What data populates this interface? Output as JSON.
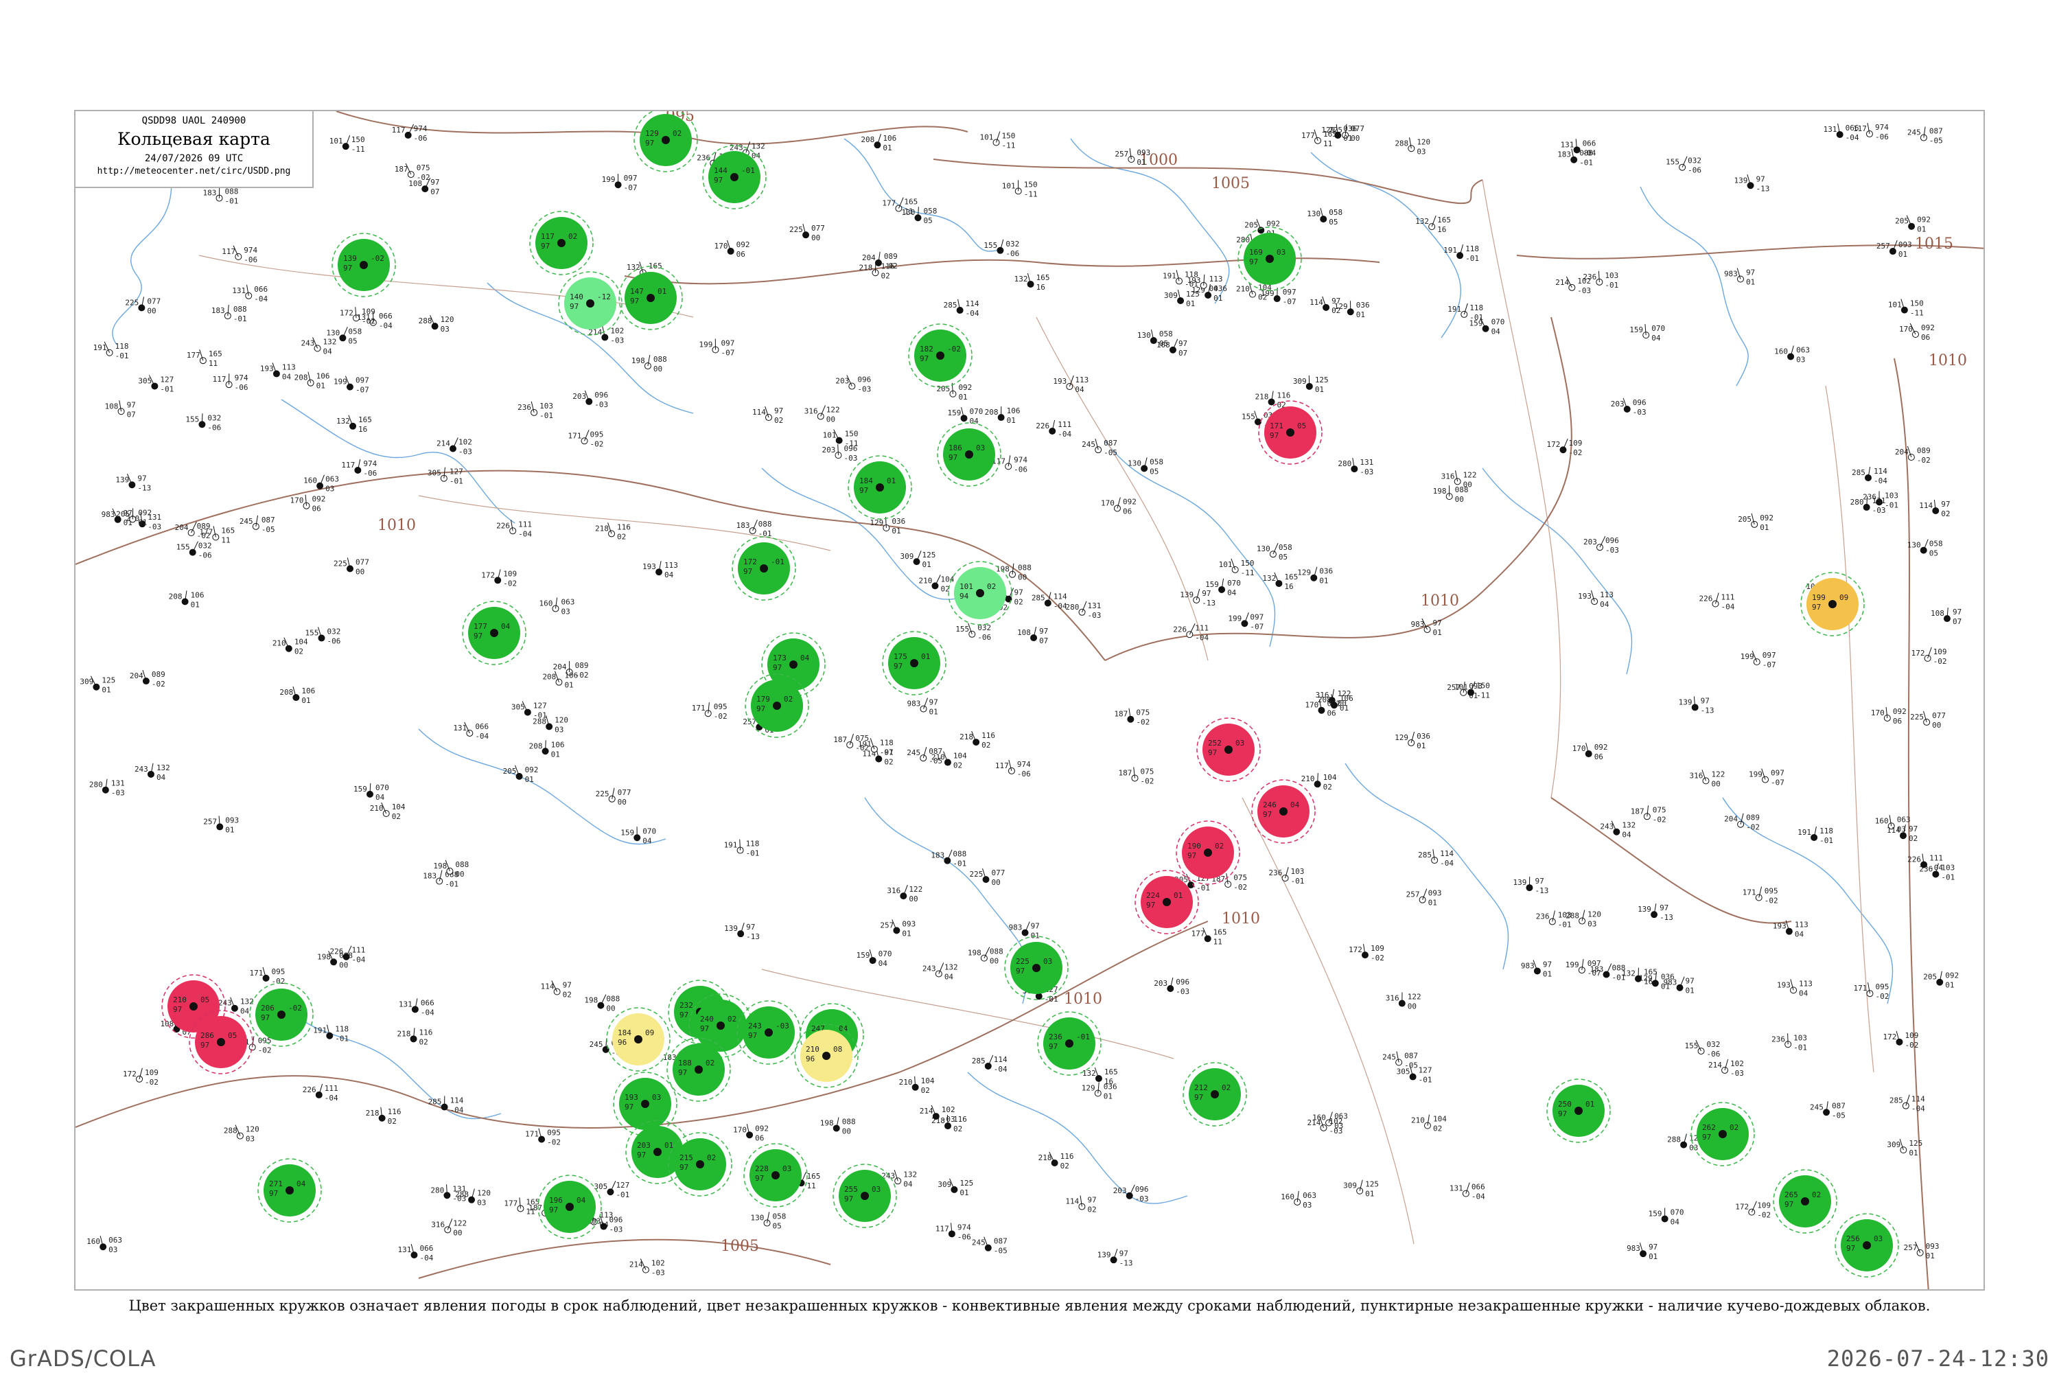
{
  "header": {
    "code": "QSDD98  UAOL  240900",
    "title": "Кольцевая карта",
    "date": "24/07/2026 09 UTC",
    "url": "http://meteocenter.net/circ/USDD.png"
  },
  "isobars": [
    "995",
    "1000",
    "1005",
    "1010",
    "1015",
    "1010",
    "1010",
    "1010",
    "1010",
    "1010",
    "1005"
  ],
  "caption": "Цвет закрашенных кружков означает явления погоды в срок наблюдений, цвет незакрашенных кружков - конвективные явления между сроками наблюдений, пунктирные незакрашенные кружки - наличие кучево-дождевых облаков.",
  "footer": {
    "left": "GrADS/COLA",
    "right": "2026-07-24-12:30"
  },
  "colors": {
    "map_background": "#ffffff",
    "rivers": "#6aa7e0",
    "borders": "#c8a090",
    "isobars": "#a0705f",
    "rain_fill": "#22b830",
    "shower_fill": "#6de88a",
    "thunder_fill": "#e8305a",
    "haze_fill": "#f4c24a",
    "fog_fill": "#f6ea8a",
    "cb_ring": "#3cb84a",
    "thunder_ring": "#d83060"
  },
  "station_samples": [
    {
      "n": "117",
      "p": "974",
      "t": "-06"
    },
    {
      "n": "983",
      "p": "97",
      "t": "01"
    },
    {
      "n": "139",
      "p": "97",
      "t": "-13"
    },
    {
      "n": "130",
      "p": "058",
      "t": "05"
    },
    {
      "n": "129",
      "p": "036",
      "t": "01"
    },
    {
      "n": "108",
      "p": "97",
      "t": "07"
    },
    {
      "n": "155",
      "p": "032",
      "t": "-06"
    },
    {
      "n": "114",
      "p": "97",
      "t": "02"
    },
    {
      "n": "131",
      "p": "066",
      "t": "-04"
    },
    {
      "n": "170",
      "p": "092",
      "t": "06"
    },
    {
      "n": "183",
      "p": "088",
      "t": "-01"
    },
    {
      "n": "171",
      "p": "095",
      "t": "-02"
    },
    {
      "n": "159",
      "p": "070",
      "t": "04"
    },
    {
      "n": "199",
      "p": "097",
      "t": "-07"
    },
    {
      "n": "208",
      "p": "106",
      "t": "01"
    },
    {
      "n": "236",
      "p": "103",
      "t": "-01"
    },
    {
      "n": "210",
      "p": "104",
      "t": "02"
    },
    {
      "n": "203",
      "p": "096",
      "t": "-03"
    },
    {
      "n": "198",
      "p": "088",
      "t": "00"
    },
    {
      "n": "245",
      "p": "087",
      "t": "-05"
    },
    {
      "n": "257",
      "p": "093",
      "t": "01"
    },
    {
      "n": "172",
      "p": "109",
      "t": "-02"
    },
    {
      "n": "193",
      "p": "113",
      "t": "04"
    },
    {
      "n": "226",
      "p": "111",
      "t": "-04"
    },
    {
      "n": "218",
      "p": "116",
      "t": "02"
    },
    {
      "n": "191",
      "p": "118",
      "t": "-01"
    },
    {
      "n": "225",
      "p": "077",
      "t": "00"
    },
    {
      "n": "160",
      "p": "063",
      "t": "03"
    },
    {
      "n": "187",
      "p": "075",
      "t": "-02"
    },
    {
      "n": "132",
      "p": "165",
      "t": "16"
    },
    {
      "n": "101",
      "p": "150",
      "t": "-11"
    },
    {
      "n": "177",
      "p": "165",
      "t": "11"
    },
    {
      "n": "214",
      "p": "102",
      "t": "-03"
    },
    {
      "n": "205",
      "p": "092",
      "t": "01"
    },
    {
      "n": "204",
      "p": "089",
      "t": "-02"
    },
    {
      "n": "243",
      "p": "132",
      "t": "04"
    },
    {
      "n": "285",
      "p": "114",
      "t": "-04"
    },
    {
      "n": "288",
      "p": "120",
      "t": "03"
    },
    {
      "n": "305",
      "p": "127",
      "t": "-01"
    },
    {
      "n": "309",
      "p": "125",
      "t": "01"
    },
    {
      "n": "280",
      "p": "131",
      "t": "-03"
    },
    {
      "n": "316",
      "p": "122",
      "t": "00"
    }
  ],
  "marker_stations": [
    {
      "t": "rain",
      "v1": "129",
      "v2": "97",
      "v3": "02"
    },
    {
      "t": "rain",
      "v1": "144",
      "v2": "97",
      "v3": "-01"
    },
    {
      "t": "rain",
      "v1": "139",
      "v2": "97",
      "v3": "-02"
    },
    {
      "t": "rain",
      "v1": "117",
      "v2": "97",
      "v3": "02"
    },
    {
      "t": "shower",
      "v1": "140",
      "v2": "97",
      "v3": "-12"
    },
    {
      "t": "rain",
      "v1": "147",
      "v2": "97",
      "v3": "01"
    },
    {
      "t": "rain",
      "v1": "169",
      "v2": "97",
      "v3": "03"
    },
    {
      "t": "thunder",
      "v1": "171",
      "v2": "97",
      "v3": "05"
    },
    {
      "t": "rain",
      "v1": "177",
      "v2": "97",
      "v3": "04"
    },
    {
      "t": "rain",
      "v1": "182",
      "v2": "97",
      "v3": "-02"
    },
    {
      "t": "rain",
      "v1": "184",
      "v2": "97",
      "v3": "01"
    },
    {
      "t": "rain",
      "v1": "186",
      "v2": "97",
      "v3": "03"
    },
    {
      "t": "shower",
      "v1": "101",
      "v2": "94",
      "v3": "02"
    },
    {
      "t": "rain",
      "v1": "172",
      "v2": "97",
      "v3": "-01"
    },
    {
      "t": "rain",
      "v1": "173",
      "v2": "97",
      "v3": "04"
    },
    {
      "t": "rain",
      "v1": "179",
      "v2": "97",
      "v3": "02"
    },
    {
      "t": "rain",
      "v1": "175",
      "v2": "97",
      "v3": "01"
    },
    {
      "t": "thunder",
      "v1": "252",
      "v2": "97",
      "v3": "03"
    },
    {
      "t": "thunder",
      "v1": "246",
      "v2": "97",
      "v3": "04"
    },
    {
      "t": "thunder",
      "v1": "190",
      "v2": "97",
      "v3": "02"
    },
    {
      "t": "thunder",
      "v1": "224",
      "v2": "97",
      "v3": "01"
    },
    {
      "t": "haze",
      "v1": "199",
      "v2": "97",
      "v3": "09"
    },
    {
      "t": "thunder",
      "v1": "210",
      "v2": "97",
      "v3": "05"
    },
    {
      "t": "rain",
      "v1": "206",
      "v2": "97",
      "v3": "-02"
    },
    {
      "t": "rain",
      "v1": "225",
      "v2": "97",
      "v3": "03"
    },
    {
      "t": "rain",
      "v1": "232",
      "v2": "97",
      "v3": "01"
    },
    {
      "t": "rain",
      "v1": "240",
      "v2": "97",
      "v3": "02"
    },
    {
      "t": "rain",
      "v1": "243",
      "v2": "97",
      "v3": "-03"
    },
    {
      "t": "rain",
      "v1": "247",
      "v2": "97",
      "v3": "04"
    },
    {
      "t": "fog",
      "v1": "184",
      "v2": "96",
      "v3": "09"
    },
    {
      "t": "rain",
      "v1": "188",
      "v2": "97",
      "v3": "02"
    },
    {
      "t": "rain",
      "v1": "193",
      "v2": "97",
      "v3": "03"
    },
    {
      "t": "fog",
      "v1": "210",
      "v2": "96",
      "v3": "08"
    },
    {
      "t": "rain",
      "v1": "196",
      "v2": "97",
      "v3": "04"
    },
    {
      "t": "rain",
      "v1": "203",
      "v2": "97",
      "v3": "01"
    },
    {
      "t": "rain",
      "v1": "215",
      "v2": "97",
      "v3": "02"
    },
    {
      "t": "rain",
      "v1": "228",
      "v2": "97",
      "v3": "03"
    },
    {
      "t": "rain",
      "v1": "236",
      "v2": "97",
      "v3": "-01"
    },
    {
      "t": "rain",
      "v1": "212",
      "v2": "97",
      "v3": "02"
    },
    {
      "t": "rain",
      "v1": "250",
      "v2": "97",
      "v3": "01"
    },
    {
      "t": "rain",
      "v1": "256",
      "v2": "97",
      "v3": "03"
    },
    {
      "t": "rain",
      "v1": "265",
      "v2": "97",
      "v3": "02"
    },
    {
      "t": "rain",
      "v1": "271",
      "v2": "97",
      "v3": "04"
    },
    {
      "t": "thunder",
      "v1": "286",
      "v2": "97",
      "v3": "05"
    },
    {
      "t": "rain",
      "v1": "255",
      "v2": "97",
      "v3": "03"
    },
    {
      "t": "rain",
      "v1": "262",
      "v2": "97",
      "v3": "02"
    }
  ]
}
